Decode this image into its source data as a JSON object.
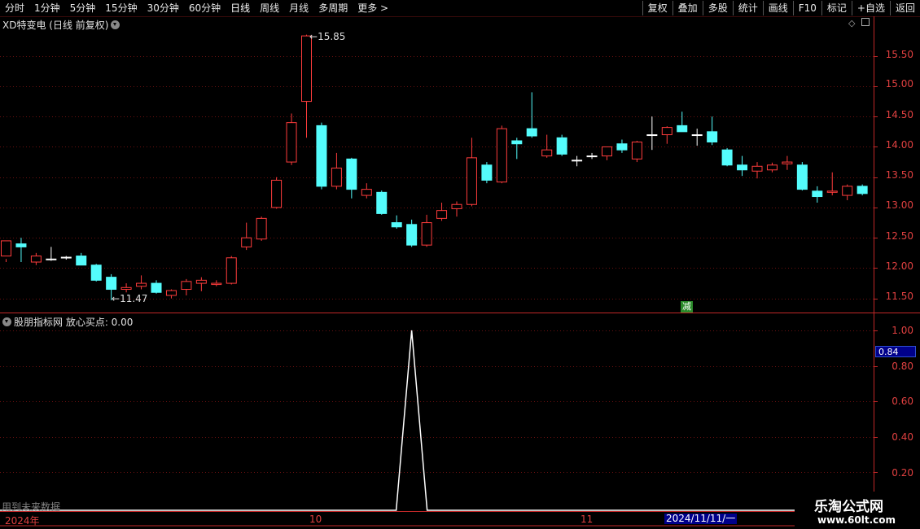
{
  "toolbar": {
    "periods": [
      "分时",
      "1分钟",
      "5分钟",
      "15分钟",
      "30分钟",
      "60分钟",
      "日线",
      "周线",
      "月线",
      "多周期",
      "更多 >"
    ],
    "buttons": [
      "复权",
      "叠加",
      "多股",
      "统计",
      "画线",
      "F10",
      "标记",
      "+自选",
      "返回"
    ]
  },
  "stock": {
    "title": "XD特变电 (日线 前复权)",
    "high_label": "15.85",
    "low_label": "11.47",
    "badge": "减",
    "y_ticks": [
      "15.50",
      "15.00",
      "14.50",
      "14.00",
      "13.50",
      "13.00",
      "12.50",
      "12.00",
      "11.50"
    ]
  },
  "indicator": {
    "title": "股朋指标网  放心买点: 0.00",
    "y_ticks": [
      "1.00",
      "0.80",
      "0.60",
      "0.40",
      "0.20"
    ],
    "cursor_value": "0.84"
  },
  "bottom": {
    "future_note": "用到未来数据",
    "x_labels": [
      "2024年",
      "10",
      "11"
    ],
    "cursor_date": "2024/11/11/一"
  },
  "watermark": {
    "name": "乐淘公式网",
    "url": "www.60lt.com"
  },
  "colors": {
    "up": "#ff3c3c",
    "down": "#54fcfc",
    "grid": "#6a1010",
    "axis": "#c02828"
  },
  "chart_data": {
    "type": "candlestick",
    "ohlc": [
      [
        12.2,
        12.45,
        12.1,
        12.15
      ],
      [
        12.4,
        12.35,
        12.5,
        12.1
      ],
      [
        12.1,
        12.2,
        12.25,
        12.05
      ],
      [
        12.15,
        12.15,
        12.35,
        12.12
      ],
      [
        12.17,
        12.18,
        12.2,
        12.14
      ],
      [
        12.2,
        12.05,
        12.25,
        12.05
      ],
      [
        12.05,
        11.8,
        12.07,
        11.78
      ],
      [
        11.85,
        11.65,
        11.9,
        11.47
      ],
      [
        11.65,
        11.68,
        11.75,
        11.6
      ],
      [
        11.7,
        11.75,
        11.88,
        11.65
      ],
      [
        11.75,
        11.6,
        11.8,
        11.58
      ],
      [
        11.55,
        11.63,
        11.65,
        11.5
      ],
      [
        11.65,
        11.78,
        11.82,
        11.55
      ],
      [
        11.75,
        11.8,
        11.85,
        11.62
      ],
      [
        11.73,
        11.75,
        11.8,
        11.7
      ],
      [
        11.75,
        12.17,
        12.2,
        11.73
      ],
      [
        12.35,
        12.5,
        12.75,
        12.3
      ],
      [
        12.48,
        12.82,
        12.85,
        12.45
      ],
      [
        13.0,
        13.45,
        13.5,
        12.98
      ],
      [
        13.75,
        14.4,
        14.55,
        13.7
      ],
      [
        14.75,
        15.83,
        15.85,
        14.15
      ],
      [
        14.35,
        13.35,
        14.4,
        13.3
      ],
      [
        13.35,
        13.65,
        13.9,
        13.3
      ],
      [
        13.8,
        13.3,
        13.82,
        13.15
      ],
      [
        13.2,
        13.3,
        13.4,
        13.15
      ],
      [
        13.25,
        12.9,
        13.28,
        12.88
      ],
      [
        12.75,
        12.68,
        12.87,
        12.65
      ],
      [
        12.72,
        12.38,
        12.8,
        12.35
      ],
      [
        12.38,
        12.75,
        12.88,
        12.35
      ],
      [
        12.82,
        12.95,
        13.08,
        12.78
      ],
      [
        12.98,
        13.05,
        13.1,
        12.85
      ],
      [
        13.05,
        13.82,
        14.15,
        13.02
      ],
      [
        13.7,
        13.45,
        13.75,
        13.4
      ],
      [
        13.42,
        14.3,
        14.35,
        13.4
      ],
      [
        14.1,
        14.05,
        14.15,
        13.8
      ],
      [
        14.3,
        14.18,
        14.9,
        14.15
      ],
      [
        13.85,
        13.95,
        14.2,
        13.82
      ],
      [
        14.15,
        13.88,
        14.2,
        13.85
      ],
      [
        13.78,
        13.78,
        13.85,
        13.68
      ],
      [
        13.85,
        13.85,
        13.9,
        13.8
      ],
      [
        13.85,
        14.0,
        14.0,
        13.78
      ],
      [
        14.05,
        13.95,
        14.12,
        13.9
      ],
      [
        13.8,
        14.08,
        14.1,
        13.75
      ],
      [
        14.2,
        14.2,
        14.5,
        13.95
      ],
      [
        14.2,
        14.32,
        14.34,
        14.05
      ],
      [
        14.35,
        14.25,
        14.58,
        14.25
      ],
      [
        14.2,
        14.2,
        14.3,
        14.02
      ],
      [
        14.25,
        14.08,
        14.5,
        14.03
      ],
      [
        13.95,
        13.7,
        13.98,
        13.68
      ],
      [
        13.7,
        13.62,
        13.85,
        13.52
      ],
      [
        13.6,
        13.68,
        13.75,
        13.48
      ],
      [
        13.62,
        13.7,
        13.74,
        13.58
      ],
      [
        13.72,
        13.75,
        13.85,
        13.62
      ],
      [
        13.7,
        13.3,
        13.75,
        13.28
      ],
      [
        13.27,
        13.18,
        13.35,
        13.08
      ],
      [
        13.25,
        13.27,
        13.58,
        13.2
      ],
      [
        13.2,
        13.35,
        13.38,
        13.12
      ],
      [
        13.35,
        13.23,
        13.38,
        13.2
      ]
    ],
    "ylim": [
      11.3,
      15.9
    ],
    "indicator": {
      "name": "放心买点",
      "values_nonzero_index": 27,
      "peak": 1.0,
      "ylim": [
        0,
        1.08
      ]
    },
    "grid": true
  }
}
